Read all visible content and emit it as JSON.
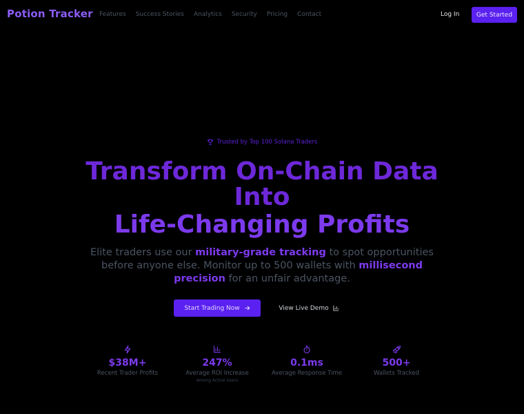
{
  "nav": {
    "logo": "Potion Tracker",
    "links": [
      "Features",
      "Success Stories",
      "Analytics",
      "Security",
      "Pricing",
      "Contact"
    ],
    "login": "Log In",
    "get_started": "Get Started"
  },
  "hero": {
    "badge": "Trusted by Top 100 Solana Traders",
    "headline_line1": "Transform On-Chain Data",
    "headline_line2": "Into",
    "headline_line3": "Life-Changing Profits",
    "sub_part1": "Elite traders use our ",
    "sub_hl1": "military-grade tracking",
    "sub_part2": " to spot opportunities before anyone else. Monitor up to 500 wallets with ",
    "sub_hl2": "millisecond precision",
    "sub_part3": " for an unfair advantage.",
    "cta_primary": "Start Trading Now",
    "cta_secondary": "View Live Demo"
  },
  "stats": [
    {
      "icon": "lightning-icon",
      "value": "$38M+",
      "label": "Recent Trader Profits",
      "note": ""
    },
    {
      "icon": "bar-chart-icon",
      "value": "247%",
      "label": "Average ROI Increase",
      "note": "Among Active Users"
    },
    {
      "icon": "stopwatch-icon",
      "value": "0.1ms",
      "label": "Average Response Time",
      "note": ""
    },
    {
      "icon": "rocket-icon",
      "value": "500+",
      "label": "Wallets Tracked",
      "note": ""
    }
  ]
}
